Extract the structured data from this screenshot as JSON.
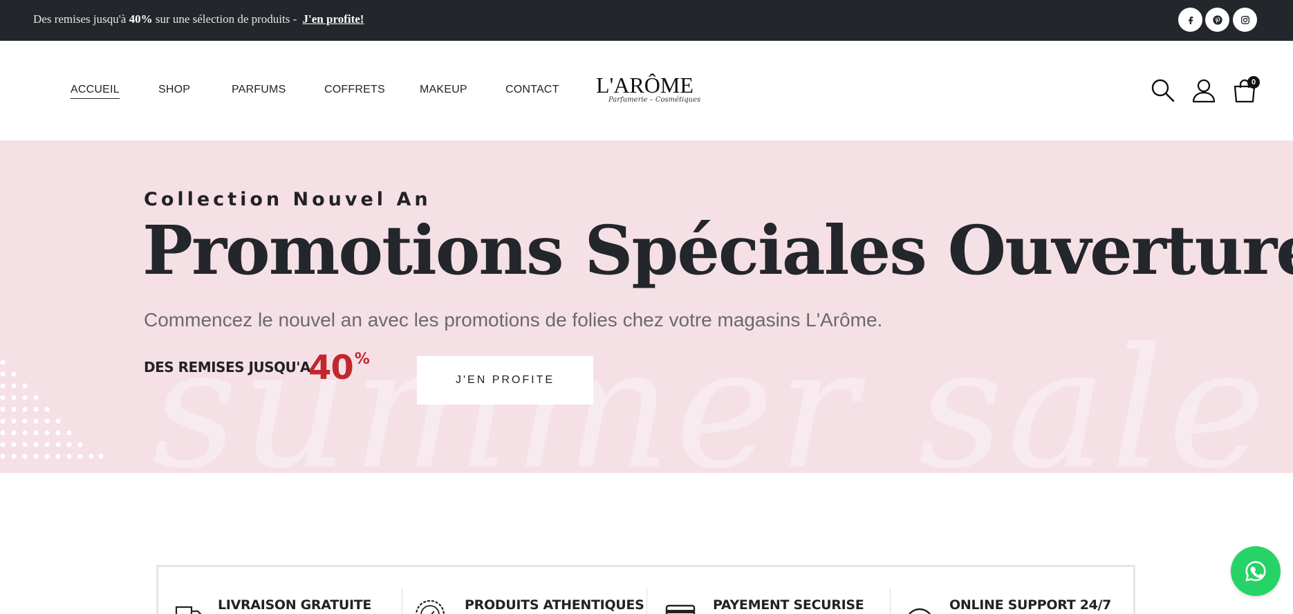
{
  "topbar": {
    "text_before": "Des remises jusqu'à ",
    "text_bold": "40%",
    "text_after": " sur une sélection de produits - ",
    "link": "J'en profite!",
    "social_icons": [
      "facebook-icon",
      "pinterest-icon",
      "instagram-icon"
    ]
  },
  "nav": {
    "items": [
      "ACCUEIL",
      "SHOP",
      "PARFUMS",
      "COFFRETS",
      "MAKEUP",
      "CONTACT"
    ]
  },
  "logo": {
    "main": "L'ARÔME",
    "sub": "Parfumerie – Cosmétiques"
  },
  "header_icons": [
    "search-icon",
    "user-icon",
    "cart-icon"
  ],
  "cart": {
    "count": "0"
  },
  "hero": {
    "eyebrow": "Collection Nouvel An",
    "title": "Promotions Spéciales Ouverture",
    "subtitle": "Commencez le nouvel an avec les promotions de folies chez votre magasins L'Arôme.",
    "deal_label": "DES REMISES JUSQU'A",
    "deal_value": "40",
    "deal_sign": "%",
    "button": "J'EN PROFITE",
    "bg_text": "summer sale"
  },
  "features": [
    {
      "title": "LIVRAISON GRATUITE",
      "icon": "truck-icon"
    },
    {
      "title": "PRODUITS ATHENTIQUES",
      "icon": "authentic-badge-icon"
    },
    {
      "title": "PAYEMENT SECURISE",
      "icon": "credit-card-icon"
    },
    {
      "title": "ONLINE SUPPORT 24/7",
      "icon": "support-icon"
    }
  ],
  "colors": {
    "topbar_bg": "#23272c",
    "hero_bg": "#f5e0e6",
    "accent_red": "#c0282d",
    "whatsapp": "#25d366"
  },
  "floating": {
    "icon": "whatsapp-icon"
  }
}
